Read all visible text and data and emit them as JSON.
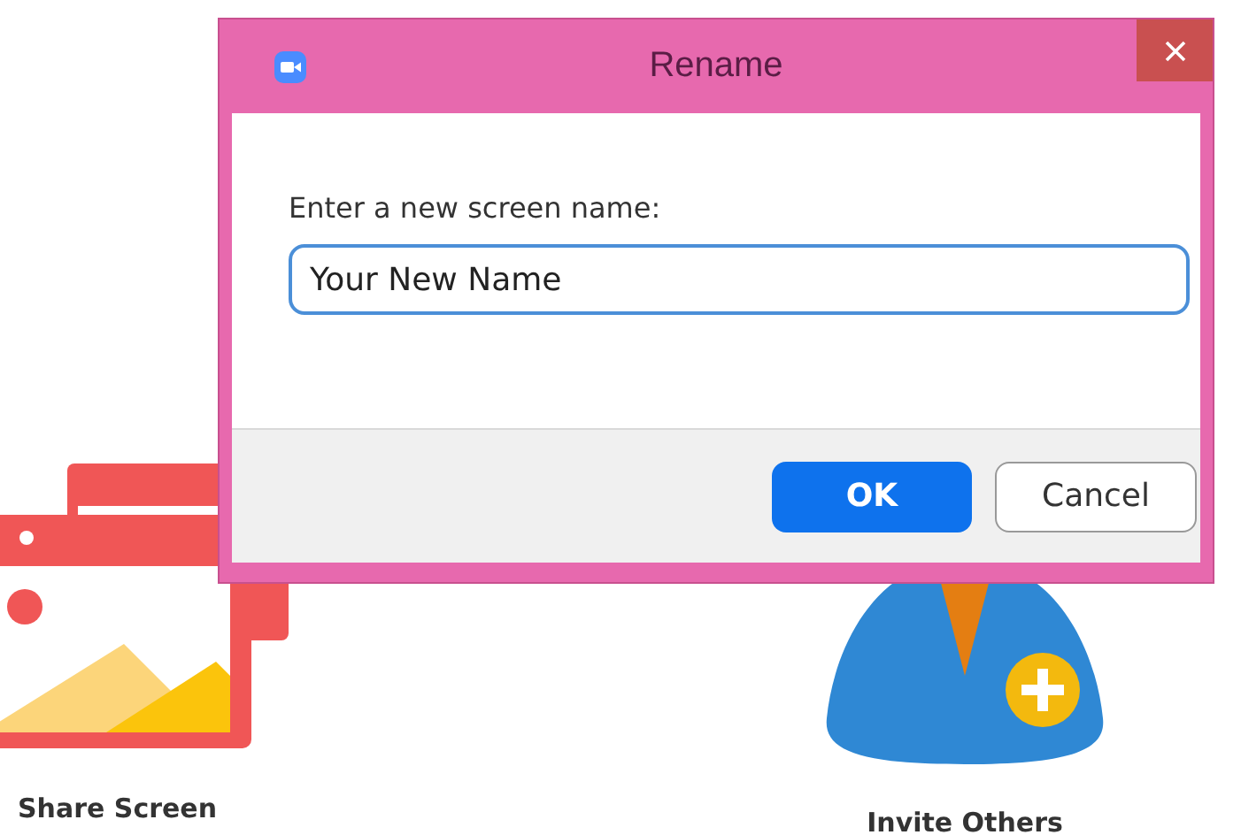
{
  "actions": [
    {
      "label": "Share Screen",
      "kind": "share"
    },
    {
      "label": "Invite Others",
      "kind": "invite"
    }
  ],
  "dialog": {
    "title": "Rename",
    "prompt": "Enter a new screen name:",
    "input": {
      "value": "Your New Name"
    },
    "buttons": [
      {
        "label": "OK",
        "kind": "primary"
      },
      {
        "label": "Cancel",
        "kind": "secondary"
      }
    ]
  }
}
